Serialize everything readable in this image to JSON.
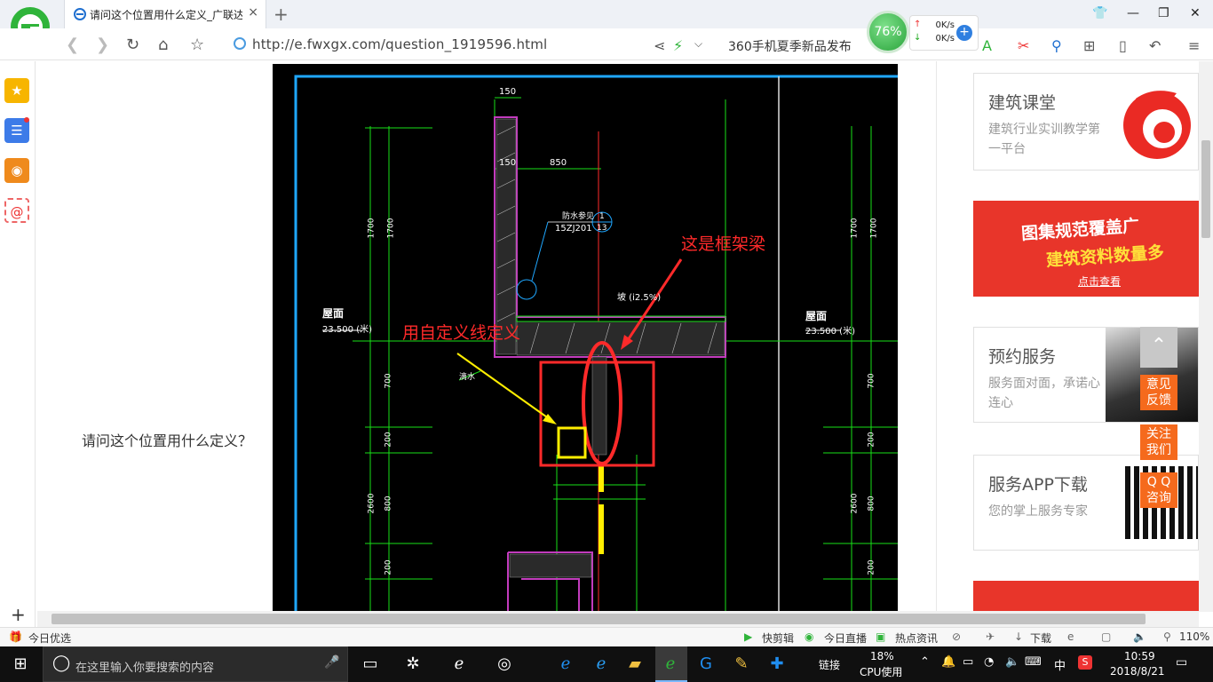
{
  "browser": {
    "tab_title": "请问这个位置用什么定义_广联达",
    "tab_close": "×",
    "new_tab": "+",
    "url": "http://e.fwxgx.com/question_1919596.html",
    "news_ticker": "360手机夏季新品发布",
    "perf_percent": "76%",
    "net_up": "0K/s",
    "net_down": "0K/s",
    "net_plus": "+",
    "window_buttons": {
      "minimize": "—",
      "restore": "❐",
      "close": "✕",
      "skin": "👕"
    }
  },
  "sidebar": {
    "add": "+"
  },
  "question_text": "请问这个位置用什么定义？",
  "cad": {
    "dim_150_top": "150",
    "dim_150": "150",
    "dim_850": "850",
    "dim_1700_a": "1700",
    "dim_1700_b": "1700",
    "dim_1700_c": "1700",
    "dim_1700_d": "1700",
    "dim_700_a": "700",
    "dim_700_b": "700",
    "dim_200_a": "200",
    "dim_200_b": "200",
    "dim_2600_a": "2600",
    "dim_2600_b": "2600",
    "dim_800_a": "800",
    "dim_800_b": "800",
    "dim_200_c": "200",
    "dim_200_d": "200",
    "roof_left": "屋面",
    "roof_left_elev": "23.500 (米)",
    "roof_right": "屋面",
    "roof_right_elev": "23.500 (米)",
    "detail_ref": "防水参见",
    "detail_code": "15ZJ201",
    "detail_num_top": "1",
    "detail_num_bot": "13",
    "slope_label": "坡 (i2.5%)",
    "drain_label": "滴水",
    "frame_beam_note": "这是框架梁",
    "custom_line_note": "用自定义线定义"
  },
  "right_column": {
    "card1": {
      "title": "建筑课堂",
      "sub": "建筑行业实训教学第一平台"
    },
    "banner": {
      "line1": "图集规范覆盖广",
      "line2": "建筑资料数量多",
      "cta": "点击查看"
    },
    "card2": {
      "title": "预约服务",
      "sub": "服务面对面，承诺心连心"
    },
    "card3": {
      "title": "服务APP下载",
      "sub": "您的掌上服务专家"
    }
  },
  "float_buttons": {
    "feedback": "意见\n反馈",
    "follow": "关注\n我们",
    "qq": "Q Q\n咨询"
  },
  "status_bar": {
    "left": "今日优选",
    "quick_clip": "快剪辑",
    "live": "今日直播",
    "hot_news": "热点资讯",
    "download": "下载",
    "zoom": "110%"
  },
  "taskbar": {
    "search_placeholder": "在这里输入你要搜索的内容",
    "link": "链接",
    "cpu_percent": "18%",
    "cpu_label": "CPU使用",
    "ime": "中",
    "time": "10:59",
    "date": "2018/8/21"
  },
  "colors": {
    "accent_orange": "#f56a1d",
    "cad_green": "#18e018",
    "cad_red": "#ff2a2a",
    "cad_magenta": "#c23bbd",
    "cad_yellow": "#ffee00",
    "cad_cyan": "#1fa7ff"
  }
}
